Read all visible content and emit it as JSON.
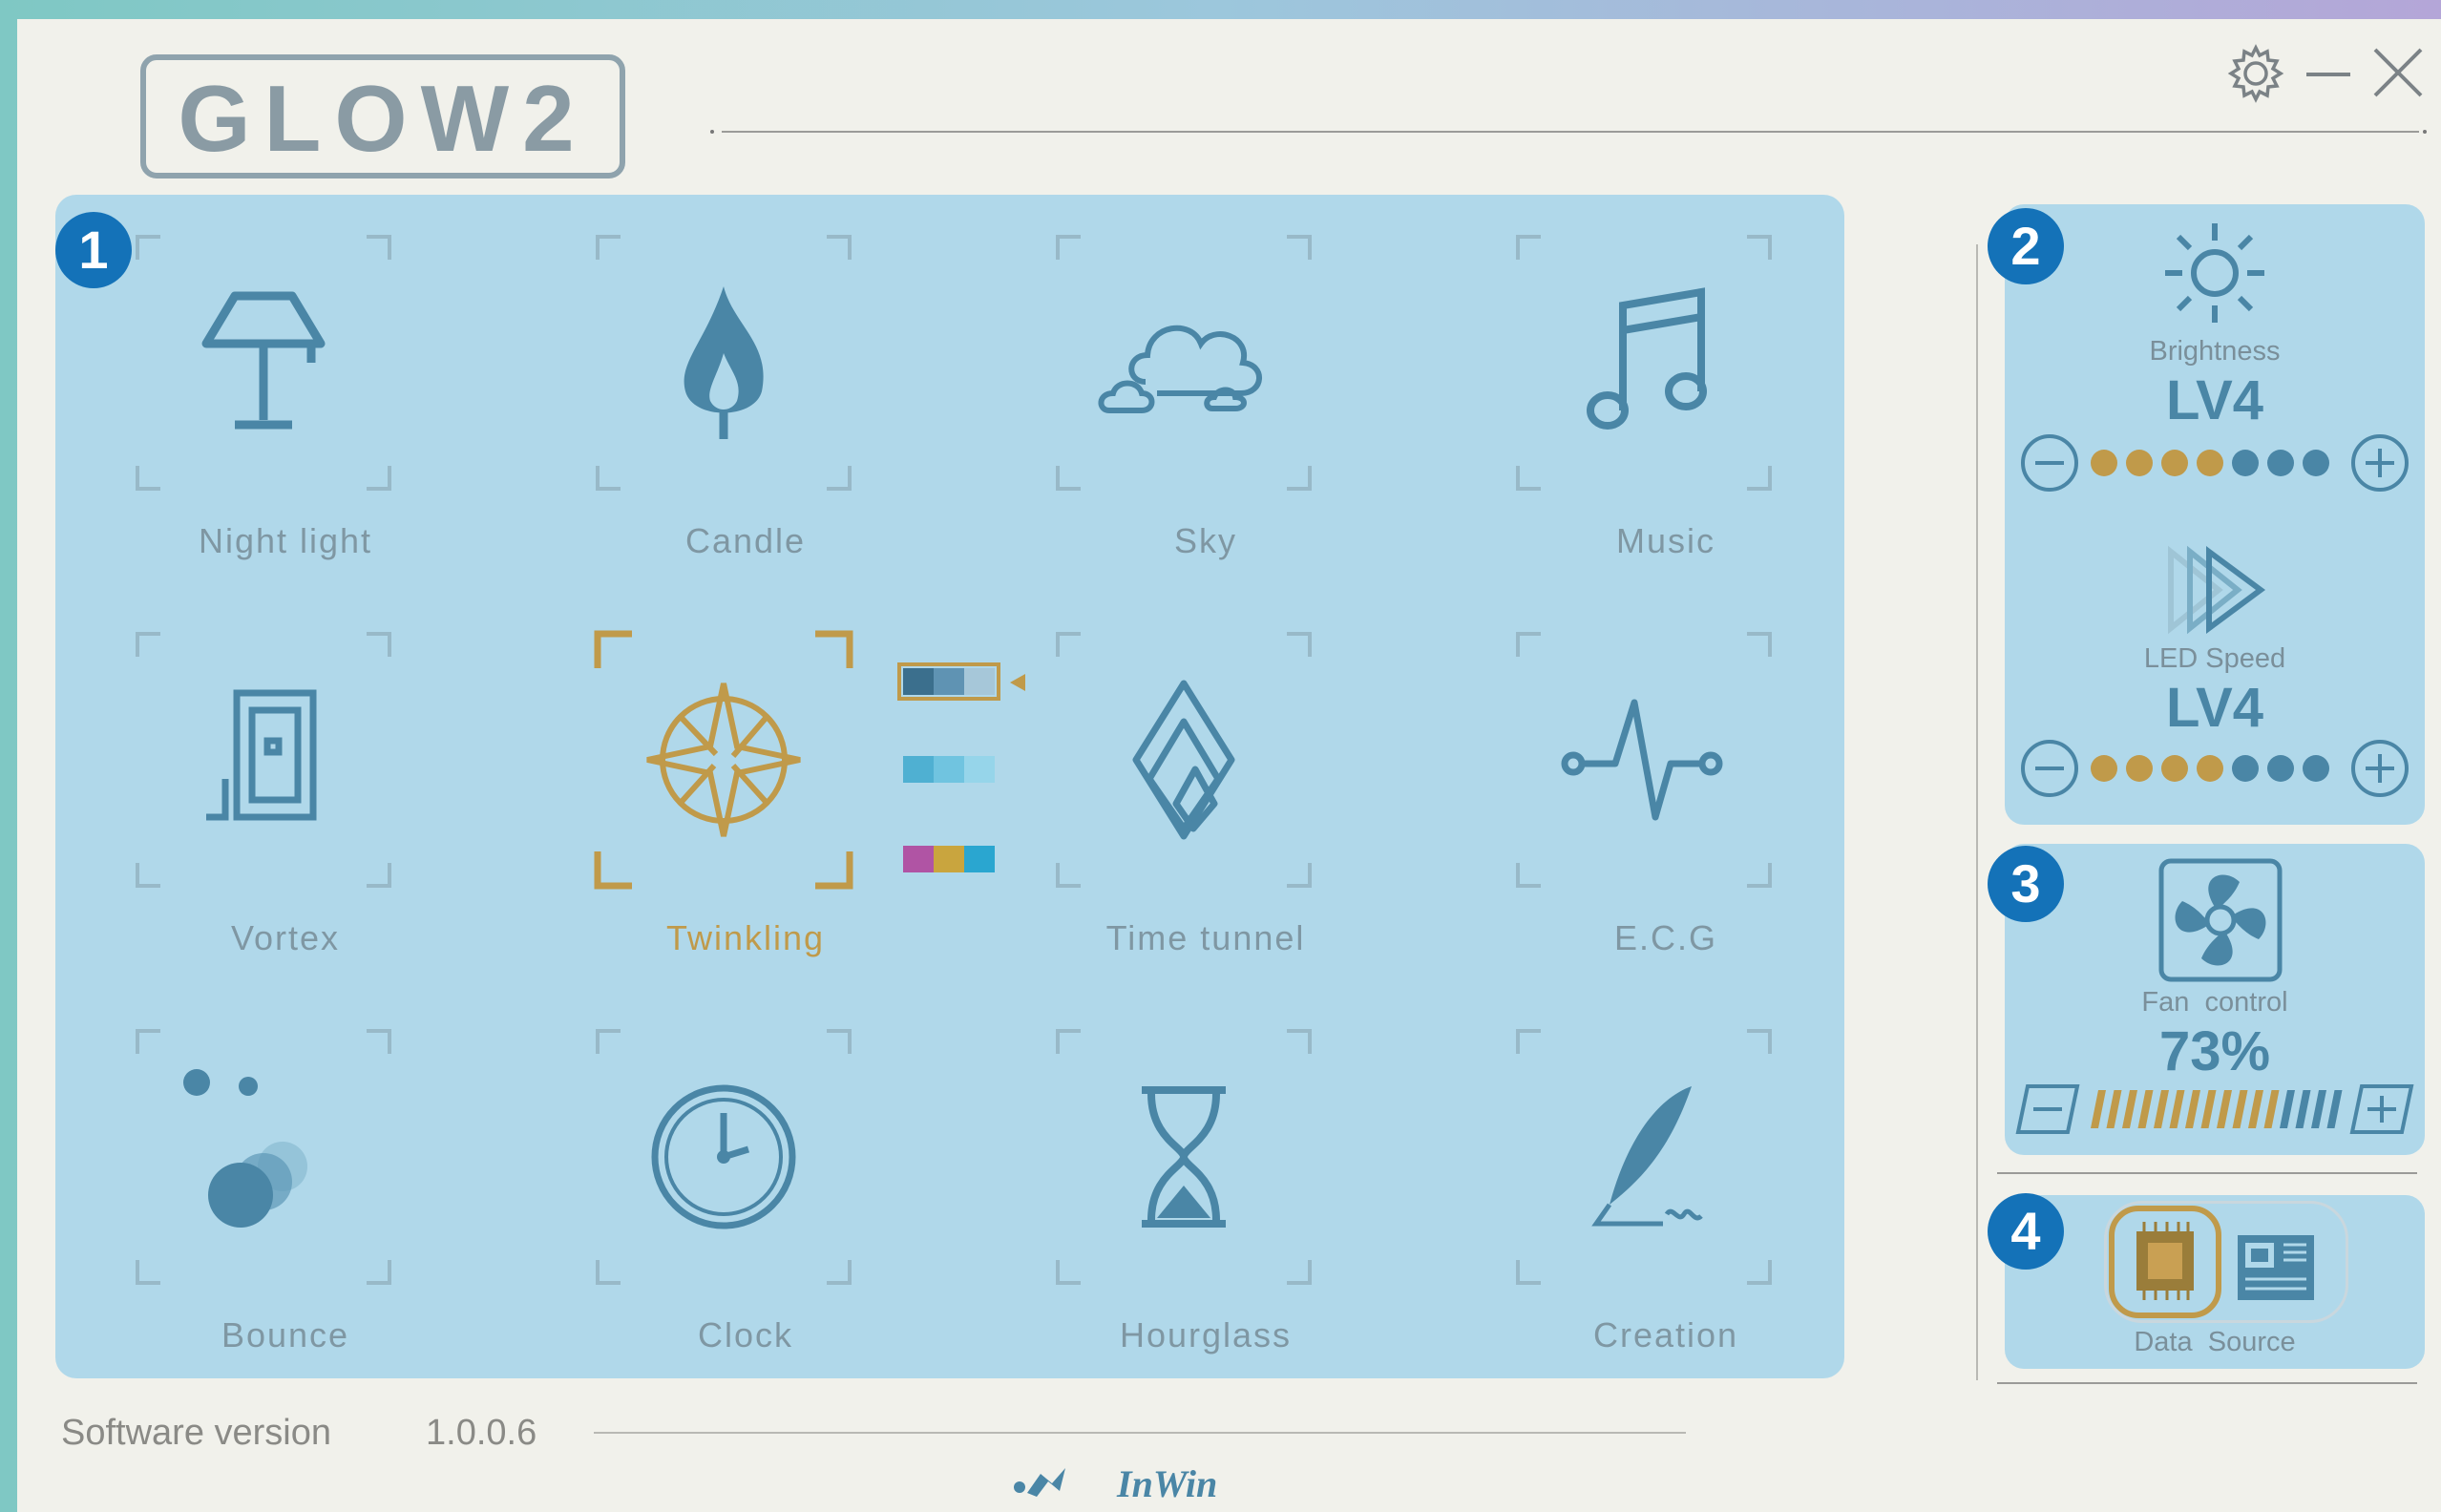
{
  "app": {
    "logo_text": "GLOW2"
  },
  "window_controls": {
    "settings": "gear-icon",
    "minimize": "minimize-icon",
    "close": "close-icon"
  },
  "modes": {
    "badge": "1",
    "items": [
      {
        "label": "Night light",
        "icon": "lamp-icon"
      },
      {
        "label": "Candle",
        "icon": "flame-icon"
      },
      {
        "label": "Sky",
        "icon": "cloud-icon"
      },
      {
        "label": "Music",
        "icon": "music-note-icon"
      },
      {
        "label": "Vortex",
        "icon": "vortex-icon"
      },
      {
        "label": "Twinkling",
        "icon": "sparkle-icon",
        "active": true
      },
      {
        "label": "Time tunnel",
        "icon": "diamond-tunnel-icon"
      },
      {
        "label": "E.C.G",
        "icon": "heartbeat-icon"
      },
      {
        "label": "Bounce",
        "icon": "bouncing-balls-icon"
      },
      {
        "label": "Clock",
        "icon": "clock-icon"
      },
      {
        "label": "Hourglass",
        "icon": "hourglass-icon"
      },
      {
        "label": "Creation",
        "icon": "feather-pen-icon"
      }
    ],
    "twinkling_color_options": [
      {
        "colors": [
          "#3b6f8d",
          "#5f93b3",
          "#a6c7d9"
        ],
        "selected": true
      },
      {
        "colors": [
          "#4fb0d2",
          "#70c4e0",
          "#96d5ea"
        ],
        "selected": false
      },
      {
        "colors": [
          "#b054a4",
          "#c9a53e",
          "#2aa6d0"
        ],
        "selected": false
      }
    ]
  },
  "lighting": {
    "badge": "2",
    "brightness": {
      "label": "Brightness",
      "level": "LV4",
      "value": 4,
      "max": 7
    },
    "speed": {
      "label": "LED Speed",
      "level": "LV4",
      "value": 4,
      "max": 7
    }
  },
  "fan": {
    "badge": "3",
    "label": "Fan  control",
    "value_text": "73%",
    "value": 0.73
  },
  "data_source": {
    "badge": "4",
    "label": "Data  Source",
    "options": [
      "cpu-chip-icon",
      "motherboard-icon"
    ],
    "selected": 0
  },
  "footer": {
    "version_label": "Software version",
    "version_value": "1.0.0.6",
    "brand": "InWin"
  },
  "colors": {
    "accent_gold": "#c09a4a",
    "panel_blue": "#b0d8ea",
    "icon_blue": "#4a86a6",
    "badge_blue": "#1472b8"
  }
}
